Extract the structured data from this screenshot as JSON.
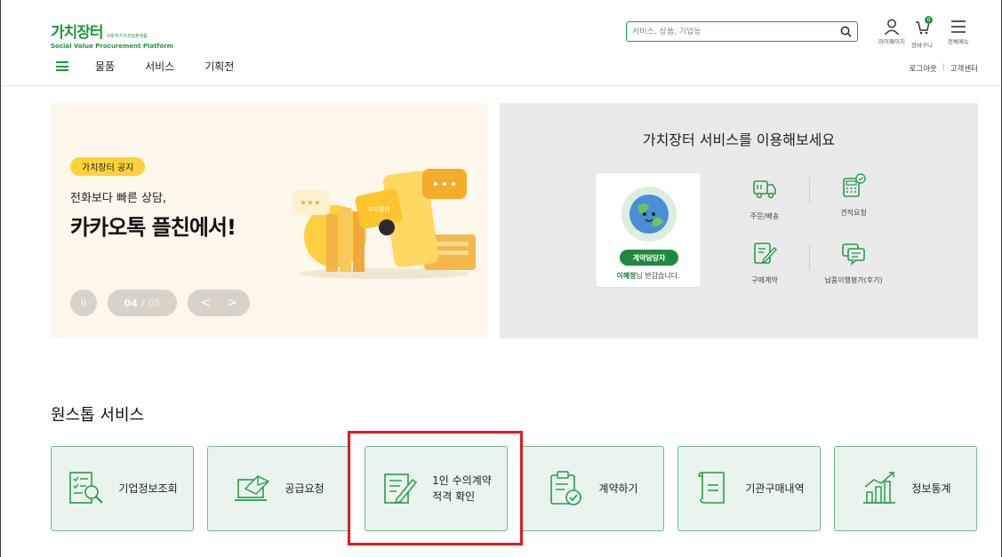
{
  "header": {
    "logo_title": "가치장터",
    "logo_small": "사회적가치조달플랫폼",
    "logo_subtitle": "Social Value Procurement Platform",
    "search_placeholder": "서비스, 상품, 기업등",
    "mypage": "마이페이지",
    "cart": "장바구니",
    "cart_count": "0",
    "all_menu": "전체메뉴",
    "nav": [
      "물품",
      "서비스",
      "기획전"
    ],
    "logout": "로그아웃",
    "separator": "|",
    "help_center": "고객센터"
  },
  "banner": {
    "badge": "가치장터 공지",
    "line1": "전화보다 빠른 상담,",
    "line2": "카카오톡 플친에서!",
    "page_current": "04",
    "page_separator": "/",
    "page_total": "05",
    "pause": "II",
    "prev": "<",
    "next": ">",
    "art_tag": "가치장터"
  },
  "service_panel": {
    "title": "가치장터 서비스를 이용해보세요",
    "role": "계약담당자",
    "user_name": "이혜정",
    "greeting": "님 반갑습니다.",
    "quick_links": [
      "주문/배송",
      "견적요청",
      "구매계약",
      "납품이행평가(후기)"
    ]
  },
  "onestop": {
    "title": "원스톱 서비스",
    "cards": [
      "기업정보조회",
      "공급요청",
      "1인 수의계약\n적격 확인",
      "계약하기",
      "기관구매내역",
      "정보통계"
    ]
  },
  "colors": {
    "brand": "#1e9a3c",
    "highlight": "#e21b1b",
    "card_bg": "#eaf4ee"
  }
}
